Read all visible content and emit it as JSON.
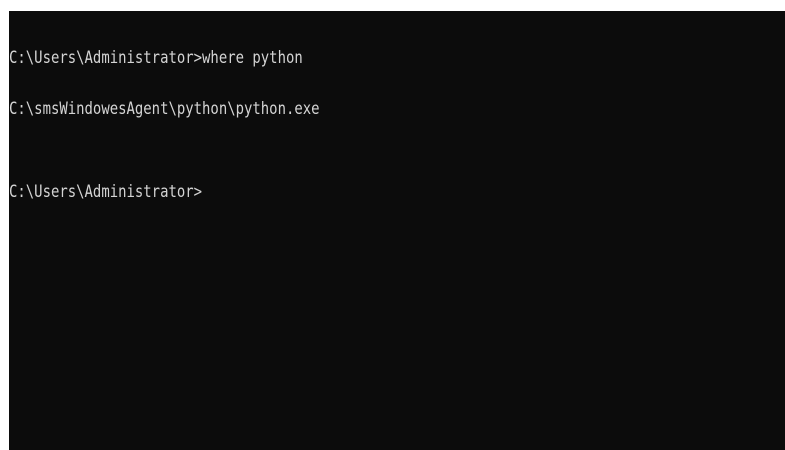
{
  "console": {
    "lines": [
      "C:\\Users\\Administrator>where python",
      "C:\\smsWindowesAgent\\python\\python.exe",
      "",
      "C:\\Users\\Administrator>"
    ],
    "colors": {
      "background": "#0c0c0c",
      "text": "#d4d4d4"
    }
  }
}
